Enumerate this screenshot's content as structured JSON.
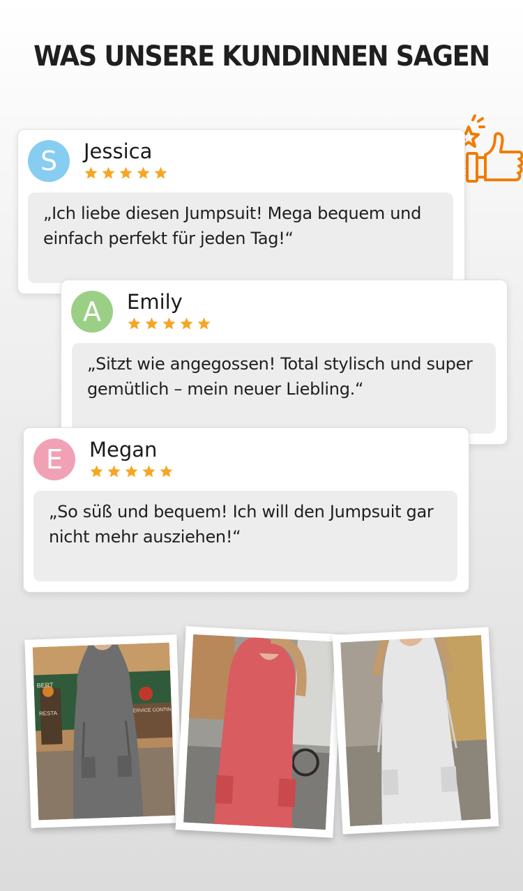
{
  "headline": "WAS UNSERE KUNDINNEN SAGEN",
  "colors": {
    "star": "#f6a623",
    "thumbs_icon": "#f07c00",
    "avatar_s": "#86cdf1",
    "avatar_a": "#9bcf86",
    "avatar_e": "#f1a1b5"
  },
  "badge_icon": "thumbs-up-icon",
  "reviews": [
    {
      "initial": "S",
      "name": "Jessica",
      "rating": 5,
      "quote": "„Ich liebe diesen Jumpsuit! Mega bequem und einfach perfekt für jeden Tag!“"
    },
    {
      "initial": "A",
      "name": "Emily",
      "rating": 5,
      "quote": "„Sitzt wie angegossen! Total stylisch und super gemütlich – mein neuer Liebling.“"
    },
    {
      "initial": "E",
      "name": "Megan",
      "rating": 5,
      "quote": "„So süß und bequem! Ich will den Jumpsuit gar nicht mehr ausziehen!“"
    }
  ],
  "photos": [
    {
      "subject": "grey jumpsuit",
      "shop_signs": [
        "BERT",
        "RESTA",
        "SERVICE CONTIN"
      ]
    },
    {
      "subject": "coral jumpsuit"
    },
    {
      "subject": "white jumpsuit"
    }
  ]
}
